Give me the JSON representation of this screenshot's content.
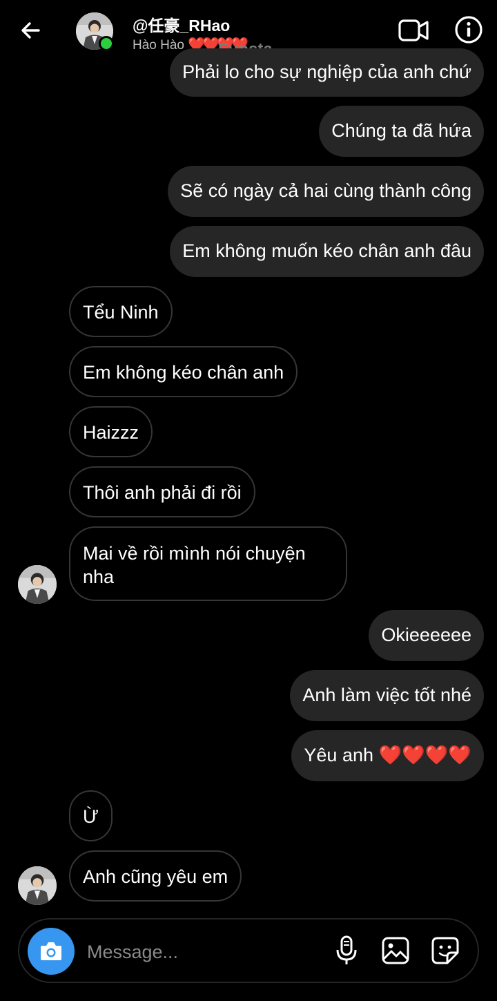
{
  "header": {
    "username": "@任豪_RHao",
    "subname": "Hào Hào",
    "subname_hearts": "❤️❤️❤️❤️",
    "watermark": "Funsta"
  },
  "messages": [
    {
      "side": "sent",
      "text": "Phải lo cho sự nghiệp của anh chứ"
    },
    {
      "side": "sent",
      "text": "Chúng ta đã hứa"
    },
    {
      "side": "sent",
      "text": "Sẽ có ngày cả hai cùng thành công"
    },
    {
      "side": "sent",
      "text": "Em không muốn kéo chân anh đâu"
    },
    {
      "side": "received",
      "text": "Tểu Ninh"
    },
    {
      "side": "received",
      "text": "Em không kéo chân anh"
    },
    {
      "side": "received",
      "text": "Haizzz"
    },
    {
      "side": "received",
      "text": "Thôi anh phải đi rồi"
    },
    {
      "side": "received",
      "text": "Mai về rồi mình nói chuyện nha"
    },
    {
      "side": "sent",
      "text": "Okieeeeee"
    },
    {
      "side": "sent",
      "text": "Anh làm việc tốt nhé"
    },
    {
      "side": "sent",
      "text": "Yêu anh",
      "hearts": "❤️❤️❤️❤️"
    },
    {
      "side": "received",
      "text": "Ừ"
    },
    {
      "side": "received",
      "text": "Anh cũng yêu em"
    }
  ],
  "composer": {
    "placeholder": "Message..."
  },
  "colors": {
    "background": "#000000",
    "sent_bubble": "#262626",
    "received_border": "#363636",
    "camera_button": "#3797f0",
    "online": "#2ecc40",
    "heart": "#e8213a"
  },
  "icons": [
    "back-arrow-icon",
    "video-call-icon",
    "info-icon",
    "camera-icon",
    "microphone-icon",
    "gallery-icon",
    "sticker-icon"
  ]
}
